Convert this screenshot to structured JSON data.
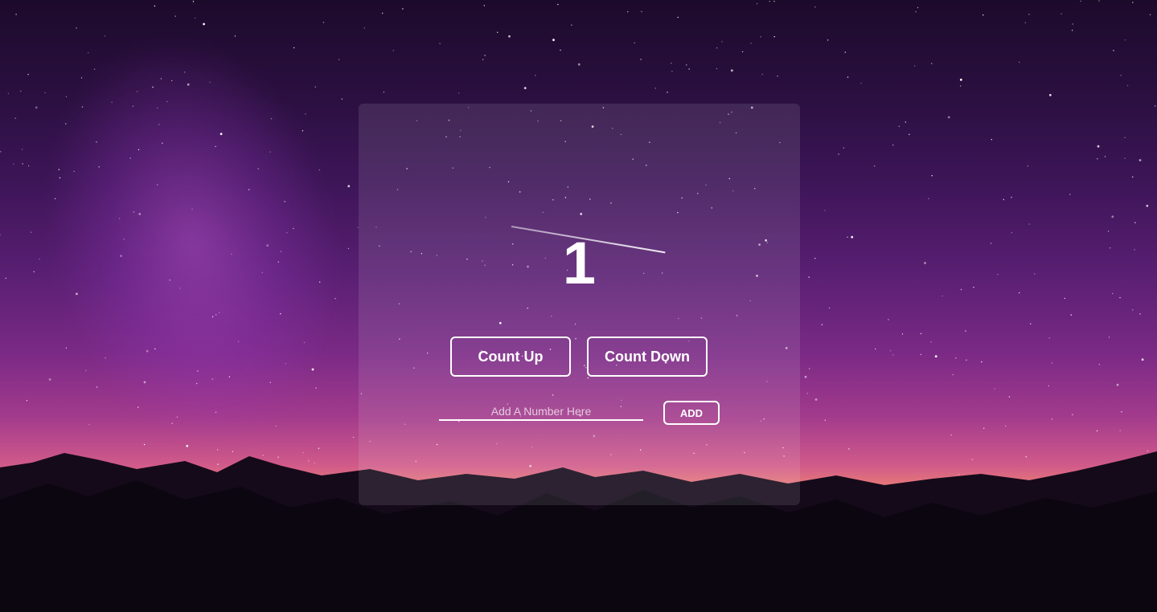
{
  "counter": {
    "value": "1"
  },
  "buttons": {
    "count_up_label": "Count Up",
    "count_down_label": "Count Down",
    "add_label": "ADD"
  },
  "input": {
    "placeholder": "Add A Number Here",
    "value": ""
  },
  "colors": {
    "text": "#ffffff",
    "card_overlay": "rgba(255,255,255,0.10)",
    "sky_top": "#1c0a2b",
    "sky_mid": "#7b2a86",
    "horizon_glow": "#f0876f",
    "mountains": "#0b0610"
  },
  "background": {
    "scene": "starry-night-sky-over-mountains"
  }
}
